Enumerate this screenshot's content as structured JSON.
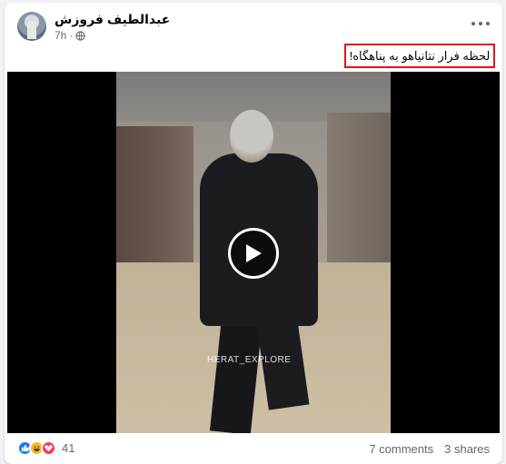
{
  "post": {
    "author": "عبدالطیف فروزش",
    "time": "7h",
    "dot": "·",
    "caption": "لحظه فرار نتانیاهو به پناهگاه!",
    "caption_highlight_color": "#e0141e"
  },
  "video": {
    "watermark": "HERAT_EXPLORE",
    "play_icon": "play-icon"
  },
  "footer": {
    "reactions": [
      "like-icon",
      "haha-icon",
      "love-icon"
    ],
    "reaction_count": "41",
    "comments": "7 comments",
    "shares": "3 shares"
  },
  "colors": {
    "accent": "#1877f2",
    "muted_text": "#65676b"
  }
}
